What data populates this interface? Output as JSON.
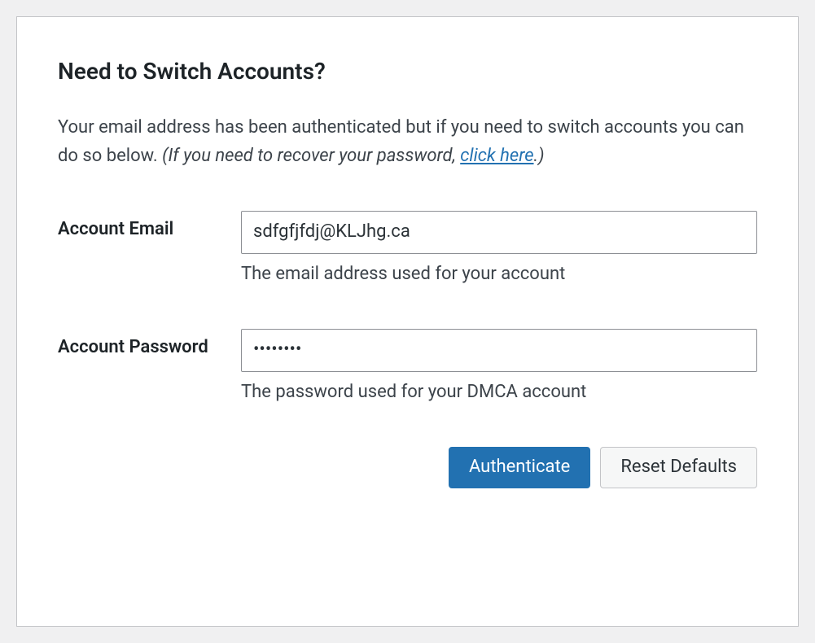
{
  "panel": {
    "title": "Need to Switch Accounts?",
    "description_text": "Your email address has been authenticated but if you need to switch accounts you can do so below. ",
    "description_italic_prefix": "(If you need to recover your password, ",
    "description_link": "click here",
    "description_italic_suffix": ".)"
  },
  "form": {
    "email": {
      "label": "Account Email",
      "value": "sdfgfjfdj@KLJhg.ca",
      "help": "The email address used for your account"
    },
    "password": {
      "label": "Account Password",
      "value": "••••••••",
      "help": "The password used for your DMCA account"
    }
  },
  "buttons": {
    "authenticate": "Authenticate",
    "reset": "Reset Defaults"
  }
}
